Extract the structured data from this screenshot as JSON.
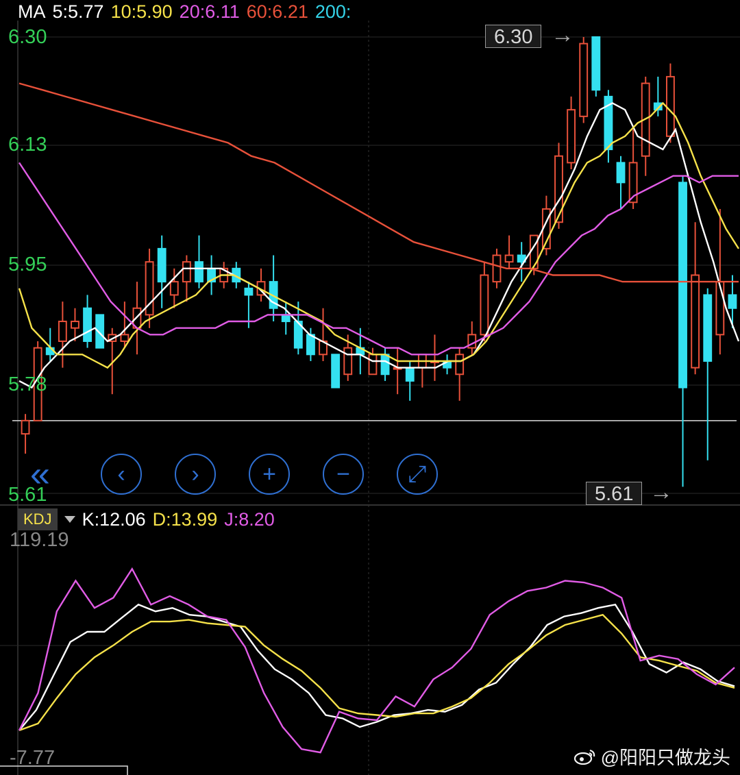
{
  "ma_legend": [
    {
      "label": "MA",
      "color": "#ffffff"
    },
    {
      "label": "5:5.77",
      "color": "#ffffff"
    },
    {
      "label": "10:5.90",
      "color": "#f6e24a"
    },
    {
      "label": "20:6.11",
      "color": "#e15ce6"
    },
    {
      "label": "60:6.21",
      "color": "#e8513a"
    },
    {
      "label": "200:",
      "color": "#34d3e8"
    }
  ],
  "kdj_legend": {
    "box": "KDJ",
    "k": "K:12.06",
    "d": "D:13.99",
    "j": "J:8.20"
  },
  "callouts": {
    "high": "6.30",
    "low": "5.61"
  },
  "watermark": "@阳阳只做龙头",
  "controls": [
    {
      "name": "scroll-back-button",
      "glyph": "«"
    },
    {
      "name": "prev-button",
      "glyph": "‹"
    },
    {
      "name": "next-button",
      "glyph": "›"
    },
    {
      "name": "zoom-in-button",
      "glyph": "+"
    },
    {
      "name": "zoom-out-button",
      "glyph": "−"
    },
    {
      "name": "fullscreen-button",
      "glyph": "⤢"
    }
  ],
  "colors": {
    "up": "#e8513a",
    "down": "#34e0f0",
    "ma5": "#ffffff",
    "ma10": "#f6e24a",
    "ma20": "#e15ce6",
    "ma60": "#e8513a",
    "k": "#ffffff",
    "d": "#f6e24a",
    "j": "#e15ce6",
    "price_axis": "#34d058",
    "kdj_axis": "#888888"
  },
  "chart_data": [
    {
      "type": "candlestick",
      "title": "",
      "y_ticks": [
        "6.30",
        "6.13",
        "5.95",
        "5.78",
        "5.61"
      ],
      "ylim": [
        5.61,
        6.3
      ],
      "reference_line": 5.72,
      "candles": [
        {
          "o": 5.7,
          "c": 5.72,
          "h": 5.73,
          "l": 5.67,
          "up": true
        },
        {
          "o": 5.72,
          "c": 5.83,
          "h": 5.84,
          "l": 5.72,
          "up": true
        },
        {
          "o": 5.83,
          "c": 5.82,
          "h": 5.86,
          "l": 5.81,
          "up": false
        },
        {
          "o": 5.84,
          "c": 5.87,
          "h": 5.9,
          "l": 5.8,
          "up": true
        },
        {
          "o": 5.86,
          "c": 5.87,
          "h": 5.89,
          "l": 5.84,
          "up": true
        },
        {
          "o": 5.89,
          "c": 5.84,
          "h": 5.91,
          "l": 5.83,
          "up": false
        },
        {
          "o": 5.88,
          "c": 5.83,
          "h": 5.88,
          "l": 5.83,
          "up": false
        },
        {
          "o": 5.84,
          "c": 5.85,
          "h": 5.86,
          "l": 5.76,
          "up": true
        },
        {
          "o": 5.84,
          "c": 5.85,
          "h": 5.9,
          "l": 5.83,
          "up": true
        },
        {
          "o": 5.86,
          "c": 5.89,
          "h": 5.93,
          "l": 5.82,
          "up": true
        },
        {
          "o": 5.88,
          "c": 5.96,
          "h": 5.98,
          "l": 5.86,
          "up": true
        },
        {
          "o": 5.98,
          "c": 5.93,
          "h": 6.0,
          "l": 5.89,
          "up": false
        },
        {
          "o": 5.91,
          "c": 5.93,
          "h": 5.95,
          "l": 5.89,
          "up": true
        },
        {
          "o": 5.93,
          "c": 5.96,
          "h": 5.97,
          "l": 5.9,
          "up": true
        },
        {
          "o": 5.96,
          "c": 5.93,
          "h": 6.0,
          "l": 5.92,
          "up": false
        },
        {
          "o": 5.95,
          "c": 5.93,
          "h": 5.97,
          "l": 5.91,
          "up": false
        },
        {
          "o": 5.93,
          "c": 5.95,
          "h": 5.96,
          "l": 5.92,
          "up": true
        },
        {
          "o": 5.95,
          "c": 5.93,
          "h": 5.96,
          "l": 5.92,
          "up": false
        },
        {
          "o": 5.92,
          "c": 5.91,
          "h": 5.93,
          "l": 5.86,
          "up": false
        },
        {
          "o": 5.91,
          "c": 5.93,
          "h": 5.95,
          "l": 5.9,
          "up": true
        },
        {
          "o": 5.93,
          "c": 5.89,
          "h": 5.97,
          "l": 5.87,
          "up": false
        },
        {
          "o": 5.88,
          "c": 5.87,
          "h": 5.9,
          "l": 5.85,
          "up": false
        },
        {
          "o": 5.87,
          "c": 5.83,
          "h": 5.9,
          "l": 5.82,
          "up": false
        },
        {
          "o": 5.85,
          "c": 5.82,
          "h": 5.86,
          "l": 5.81,
          "up": false
        },
        {
          "o": 5.82,
          "c": 5.84,
          "h": 5.89,
          "l": 5.81,
          "up": true
        },
        {
          "o": 5.82,
          "c": 5.77,
          "h": 5.82,
          "l": 5.77,
          "up": false
        },
        {
          "o": 5.79,
          "c": 5.83,
          "h": 5.85,
          "l": 5.78,
          "up": true
        },
        {
          "o": 5.83,
          "c": 5.82,
          "h": 5.86,
          "l": 5.79,
          "up": false
        },
        {
          "o": 5.79,
          "c": 5.82,
          "h": 5.83,
          "l": 5.79,
          "up": true
        },
        {
          "o": 5.82,
          "c": 5.79,
          "h": 5.83,
          "l": 5.78,
          "up": false
        },
        {
          "o": 5.8,
          "c": 5.8,
          "h": 5.83,
          "l": 5.76,
          "up": true
        },
        {
          "o": 5.8,
          "c": 5.78,
          "h": 5.81,
          "l": 5.75,
          "up": false
        },
        {
          "o": 5.8,
          "c": 5.82,
          "h": 5.82,
          "l": 5.77,
          "up": true
        },
        {
          "o": 5.81,
          "c": 5.81,
          "h": 5.85,
          "l": 5.78,
          "up": true
        },
        {
          "o": 5.81,
          "c": 5.8,
          "h": 5.82,
          "l": 5.79,
          "up": false
        },
        {
          "o": 5.79,
          "c": 5.82,
          "h": 5.83,
          "l": 5.75,
          "up": true
        },
        {
          "o": 5.83,
          "c": 5.85,
          "h": 5.87,
          "l": 5.82,
          "up": true
        },
        {
          "o": 5.85,
          "c": 5.94,
          "h": 5.96,
          "l": 5.84,
          "up": true
        },
        {
          "o": 5.93,
          "c": 5.97,
          "h": 5.98,
          "l": 5.92,
          "up": true
        },
        {
          "o": 5.96,
          "c": 5.97,
          "h": 6.0,
          "l": 5.95,
          "up": true
        },
        {
          "o": 5.97,
          "c": 5.96,
          "h": 5.99,
          "l": 5.93,
          "up": false
        },
        {
          "o": 5.95,
          "c": 6.0,
          "h": 6.0,
          "l": 5.94,
          "up": true
        },
        {
          "o": 5.98,
          "c": 6.04,
          "h": 6.06,
          "l": 5.97,
          "up": true
        },
        {
          "o": 6.02,
          "c": 6.12,
          "h": 6.14,
          "l": 6.01,
          "up": true
        },
        {
          "o": 6.11,
          "c": 6.19,
          "h": 6.21,
          "l": 6.1,
          "up": true
        },
        {
          "o": 6.18,
          "c": 6.29,
          "h": 6.3,
          "l": 6.17,
          "up": true
        },
        {
          "o": 6.3,
          "c": 6.22,
          "h": 6.3,
          "l": 6.21,
          "up": false
        },
        {
          "o": 6.21,
          "c": 6.13,
          "h": 6.22,
          "l": 6.11,
          "up": false
        },
        {
          "o": 6.11,
          "c": 6.08,
          "h": 6.12,
          "l": 6.04,
          "up": false
        },
        {
          "o": 6.05,
          "c": 6.11,
          "h": 6.16,
          "l": 6.04,
          "up": true
        },
        {
          "o": 6.12,
          "c": 6.23,
          "h": 6.24,
          "l": 6.09,
          "up": true
        },
        {
          "o": 6.2,
          "c": 6.19,
          "h": 6.24,
          "l": 6.18,
          "up": false
        },
        {
          "o": 6.15,
          "c": 6.24,
          "h": 6.26,
          "l": 6.14,
          "up": true
        },
        {
          "o": 6.08,
          "c": 5.77,
          "h": 6.09,
          "l": 5.62,
          "up": false
        },
        {
          "o": 5.8,
          "c": 5.94,
          "h": 6.02,
          "l": 5.79,
          "up": true
        },
        {
          "o": 5.91,
          "c": 5.81,
          "h": 5.92,
          "l": 5.66,
          "up": false
        },
        {
          "o": 5.85,
          "c": 5.93,
          "h": 6.04,
          "l": 5.82,
          "up": true
        },
        {
          "o": 5.91,
          "c": 5.89,
          "h": 5.94,
          "l": 5.86,
          "up": false
        }
      ],
      "series": [
        {
          "name": "5",
          "values": [
            5.78,
            5.77,
            5.8,
            5.82,
            5.84,
            5.85,
            5.86,
            5.84,
            5.85,
            5.87,
            5.89,
            5.91,
            5.93,
            5.95,
            5.95,
            5.95,
            5.95,
            5.94,
            5.93,
            5.92,
            5.9,
            5.89,
            5.87,
            5.85,
            5.84,
            5.83,
            5.82,
            5.82,
            5.81,
            5.81,
            5.8,
            5.8,
            5.8,
            5.8,
            5.81,
            5.81,
            5.82,
            5.85,
            5.89,
            5.93,
            5.96,
            5.99,
            6.03,
            6.06,
            6.1,
            6.15,
            6.19,
            6.2,
            6.19,
            6.15,
            6.14,
            6.13,
            6.16,
            6.09,
            6.02,
            5.96,
            5.89,
            5.84
          ]
        },
        {
          "name": "10",
          "values": [
            5.92,
            5.86,
            5.84,
            5.82,
            5.82,
            5.82,
            5.81,
            5.8,
            5.82,
            5.85,
            5.87,
            5.88,
            5.89,
            5.9,
            5.91,
            5.93,
            5.94,
            5.94,
            5.93,
            5.92,
            5.91,
            5.9,
            5.89,
            5.88,
            5.87,
            5.85,
            5.84,
            5.83,
            5.82,
            5.82,
            5.81,
            5.81,
            5.81,
            5.81,
            5.81,
            5.81,
            5.82,
            5.84,
            5.87,
            5.9,
            5.93,
            5.96,
            6.0,
            6.04,
            6.08,
            6.11,
            6.12,
            6.14,
            6.15,
            6.17,
            6.18,
            6.2,
            6.18,
            6.14,
            6.09,
            6.05,
            6.01,
            5.98
          ]
        },
        {
          "name": "20",
          "values": [
            6.11,
            6.08,
            6.05,
            6.02,
            5.99,
            5.96,
            5.93,
            5.9,
            5.88,
            5.86,
            5.85,
            5.85,
            5.86,
            5.86,
            5.86,
            5.86,
            5.87,
            5.87,
            5.87,
            5.88,
            5.88,
            5.88,
            5.88,
            5.87,
            5.86,
            5.86,
            5.85,
            5.84,
            5.83,
            5.83,
            5.82,
            5.82,
            5.82,
            5.83,
            5.83,
            5.84,
            5.85,
            5.86,
            5.88,
            5.9,
            5.93,
            5.96,
            5.98,
            6.0,
            6.01,
            6.03,
            6.04,
            6.06,
            6.07,
            6.08,
            6.09,
            6.09,
            6.08,
            6.09,
            6.09,
            6.09
          ]
        },
        {
          "name": "60",
          "values": [
            6.23,
            6.22,
            6.21,
            6.2,
            6.19,
            6.18,
            6.17,
            6.16,
            6.15,
            6.14,
            6.12,
            6.11,
            6.09,
            6.07,
            6.05,
            6.03,
            6.01,
            5.99,
            5.98,
            5.97,
            5.96,
            5.95,
            5.95,
            5.94,
            5.94,
            5.94,
            5.93,
            5.93,
            5.93,
            5.93,
            5.93,
            5.93
          ]
        }
      ]
    },
    {
      "type": "line",
      "title": "",
      "y_ticks": [
        "119.19",
        "-7.77"
      ],
      "ylim": [
        -7.77,
        119.19
      ],
      "series": [
        {
          "name": "K",
          "values": [
            8,
            20,
            40,
            60,
            66,
            66,
            74,
            82,
            78,
            80,
            76,
            75,
            72,
            69,
            55,
            44,
            38,
            30,
            17,
            15,
            10,
            13,
            17,
            18,
            20,
            19,
            23,
            32,
            36,
            47,
            57,
            70,
            75,
            77,
            80,
            82,
            66,
            47,
            42,
            48,
            44,
            37,
            34
          ]
        },
        {
          "name": "D",
          "values": [
            8,
            12,
            27,
            41,
            51,
            58,
            66,
            72,
            72,
            73,
            71,
            70,
            69,
            58,
            50,
            43,
            33,
            21,
            18,
            17,
            16,
            18,
            18,
            22,
            27,
            36,
            47,
            55,
            64,
            70,
            73,
            76,
            65,
            51,
            49,
            46,
            43,
            36,
            33
          ]
        },
        {
          "name": "J",
          "values": [
            8,
            30,
            78,
            96,
            80,
            86,
            103,
            82,
            87,
            82,
            75,
            73,
            57,
            30,
            10,
            -3,
            -5,
            19,
            15,
            14,
            28,
            22,
            38,
            45,
            56,
            76,
            84,
            90,
            92,
            96,
            95,
            92,
            86,
            49,
            52,
            50,
            41,
            35,
            45
          ]
        }
      ]
    }
  ]
}
